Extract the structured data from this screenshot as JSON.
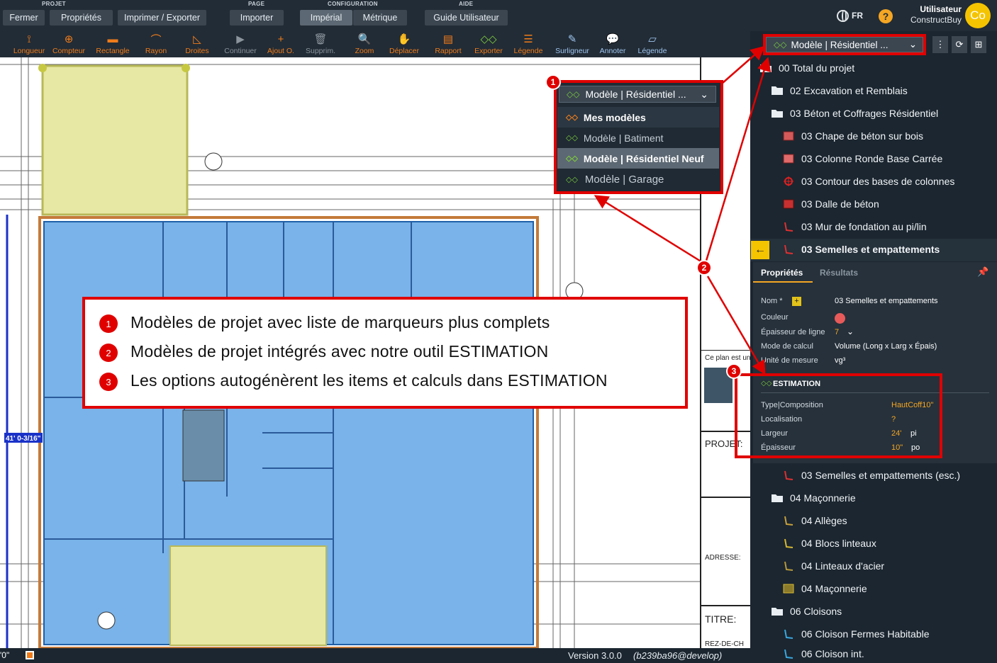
{
  "menubar": {
    "groups": [
      {
        "label": "PROJET"
      },
      {
        "label": "PAGE"
      },
      {
        "label": "CONFIGURATION"
      },
      {
        "label": "AIDE"
      }
    ],
    "buttons": {
      "fermer": "Fermer",
      "proprietes": "Propriétés",
      "imprimer": "Imprimer / Exporter",
      "importer": "Importer",
      "imperial": "Impérial",
      "metrique": "Métrique",
      "guide": "Guide Utilisateur"
    },
    "language": "FR",
    "help": "?",
    "user_label": "Utilisateur",
    "user_name": "ConstructBuy",
    "avatar_initials": "Co"
  },
  "toolbar": {
    "tools": [
      {
        "label": "Longueur"
      },
      {
        "label": "Compteur"
      },
      {
        "label": "Rectangle"
      },
      {
        "label": "Rayon"
      },
      {
        "label": "Droites"
      },
      {
        "label": "Continuer"
      },
      {
        "label": "Ajout O."
      },
      {
        "label": "Supprim."
      },
      {
        "label": "Zoom"
      },
      {
        "label": "Déplacer"
      },
      {
        "label": "Rapport"
      },
      {
        "label": "Exporter"
      },
      {
        "label": "Légende"
      },
      {
        "label": "Surligneur"
      },
      {
        "label": "Annoter"
      },
      {
        "label": "Légende"
      }
    ]
  },
  "model_selector": {
    "value": "Modèle | Résidentiel ..."
  },
  "dropdown": {
    "selected": "Modèle | Résidentiel ...",
    "items": [
      {
        "label": "Mes modèles"
      },
      {
        "label": "Modèle | Batiment"
      },
      {
        "label": "Modèle | Résidentiel Neuf"
      },
      {
        "label": "Modèle | Garage"
      }
    ]
  },
  "tree": {
    "items": [
      {
        "label": "00 Total du projet",
        "icon": "folder-open-icon"
      },
      {
        "label": "02 Excavation et Remblais",
        "icon": "folder-icon"
      },
      {
        "label": "03 Béton et Coffrages Résidentiel",
        "icon": "folder-open-icon"
      },
      {
        "label": "03 Chape de béton sur bois",
        "icon": "area-icon"
      },
      {
        "label": "03 Colonne Ronde Base Carrée",
        "icon": "area-icon"
      },
      {
        "label": "03 Contour des bases de colonnes",
        "icon": "counter-icon"
      },
      {
        "label": "03 Dalle de béton",
        "icon": "area-icon"
      },
      {
        "label": "03 Mur de fondation au pi/lin",
        "icon": "linear-icon"
      },
      {
        "label": "03 Semelles et empattements",
        "icon": "linear-icon"
      },
      {
        "label": "03 Semelles et empattements (esc.)",
        "icon": "linear-icon"
      },
      {
        "label": "04 Maçonnerie",
        "icon": "folder-open-icon"
      },
      {
        "label": "04 Allèges",
        "icon": "linear-icon"
      },
      {
        "label": "04 Blocs linteaux",
        "icon": "linear-icon"
      },
      {
        "label": "04 Linteaux d'acier",
        "icon": "linear-icon"
      },
      {
        "label": "04 Maçonnerie",
        "icon": "area-icon"
      },
      {
        "label": "06 Cloisons",
        "icon": "folder-open-icon"
      },
      {
        "label": "06 Cloison Fermes Habitable",
        "icon": "linear-icon"
      },
      {
        "label": "06 Cloison int.",
        "icon": "linear-icon"
      }
    ]
  },
  "properties": {
    "tabs": [
      "Propriétés",
      "Résultats"
    ],
    "nom_label": "Nom *",
    "nom_value": "03 Semelles et empattements",
    "couleur_label": "Couleur",
    "couleur_value": "#e85a5a",
    "epaisseur_label": "Épaisseur de ligne",
    "epaisseur_value": "7",
    "mode_label": "Mode de calcul",
    "mode_value": "Volume (Long x Larg x Épais)",
    "unite_label": "Unité de mesure",
    "unite_value": "vg³"
  },
  "estimation": {
    "title": "ESTIMATION",
    "rows": [
      {
        "label": "Type|Composition",
        "value": "HautCoff10\"",
        "unit": ""
      },
      {
        "label": "Localisation",
        "value": "?",
        "unit": ""
      },
      {
        "label": "Largeur",
        "value": "24'",
        "unit": "pi"
      },
      {
        "label": "Épaisseur",
        "value": "10\"",
        "unit": "po"
      }
    ]
  },
  "annotations": {
    "lines": [
      {
        "num": "1",
        "text": "Modèles de projet avec liste de marqueurs plus complets"
      },
      {
        "num": "2",
        "text": "Modèles de projet intégrés avec notre outil ESTIMATION"
      },
      {
        "num": "3",
        "text": "Les options autogénèrent les items et calculs dans ESTIMATION"
      }
    ],
    "badges": [
      "1",
      "2",
      "3"
    ]
  },
  "plan": {
    "dimension": "41' 0-3/16\"",
    "title_labels": [
      "PROJET:",
      "ADRESSE:",
      "TITRE:",
      "REZ-DE-CH"
    ],
    "plan_note": "Ce plan est un",
    "coord": "'0\""
  },
  "footer": {
    "version": "Version 3.0.0",
    "branch": "(b239ba96@develop)"
  },
  "colors": {
    "accent_orange": "#f07c1a",
    "accent_green": "#7ccc3b",
    "callout_red": "#e00000",
    "blue_area": "#79b3e9",
    "yellow_area": "#e7e8a4"
  }
}
